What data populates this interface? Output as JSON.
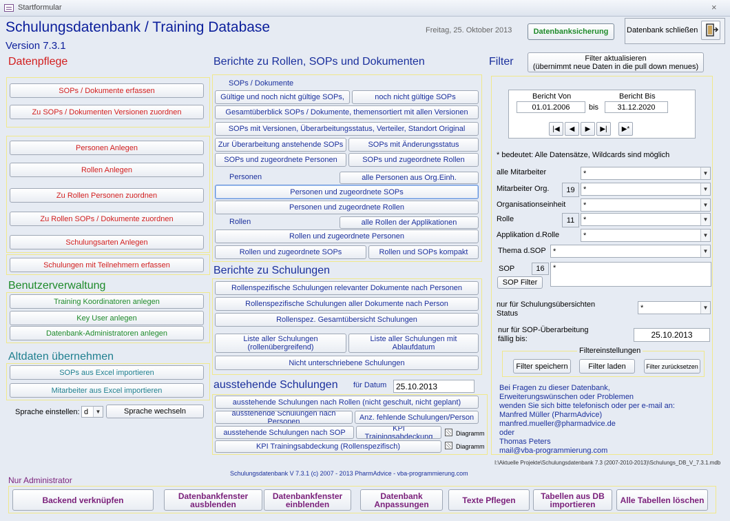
{
  "window": {
    "title": "Startformular",
    "close": "×"
  },
  "header": {
    "title": "Schulungsdatenbank / Training Database",
    "version": "Version 7.3.1",
    "date": "Freitag, 25. Oktober 2013",
    "backup_button": "Datenbanksicherung",
    "close_db_button": "Datenbank schließen"
  },
  "datenpflege": {
    "heading": "Datenpflege",
    "buttons": [
      "SOPs / Dokumente  erfassen",
      "Zu SOPs / Dokumenten Versionen zuordnen",
      "Personen Anlegen",
      "Rollen Anlegen",
      "Zu Rollen Personen zuordnen",
      "Zu Rollen SOPs  / Dokumente zuordnen",
      "Schulungsarten Anlegen",
      "Schulungen mit Teilnehmern erfassen"
    ]
  },
  "benutzer": {
    "heading": "Benutzerverwaltung",
    "buttons": [
      "Training Koordinatoren anlegen",
      "Key User anlegen",
      "Datenbank-Administratoren anlegen"
    ]
  },
  "altdaten": {
    "heading": "Altdaten übernehmen",
    "buttons": [
      "SOPs aus Excel importieren",
      "Mitarbeiter aus Excel importieren"
    ]
  },
  "sprache": {
    "label": "Sprache einstellen:",
    "value": "d",
    "button": "Sprache wechseln"
  },
  "berichte_rollen": {
    "heading": "Berichte zu Rollen, SOPs und Dokumenten",
    "sops_label": "SOPs / Dokumente",
    "personen_label": "Personen",
    "rollen_label": "Rollen",
    "b1": "Gültige und noch nicht gültige SOPs,",
    "b2": "noch nicht gültige SOPs",
    "b3": "Gesamtüberblick SOPs / Dokumente, themensortiert mit allen Versionen",
    "b4": "SOPs mit Versionen,  Überarbeitungsstatus, Verteiler, Standort Original",
    "b5": "Zur Überarbeitung anstehende SOPs",
    "b6": "SOPs mit Änderungsstatus",
    "b7": "SOPs und zugeordnete Personen",
    "b8": "SOPs und zugeordnete Rollen",
    "b9": "alle Personen aus Org.Einh.",
    "b10": "Personen und zugeordnete SOPs",
    "b11": "Personen und zugeordnete Rollen",
    "b12": "alle Rollen der Applikationen",
    "b13": "Rollen und zugeordnete Personen",
    "b14": "Rollen und zugeordnete SOPs",
    "b15": "Rollen und SOPs kompakt"
  },
  "berichte_schulungen": {
    "heading": "Berichte zu Schulungen",
    "b1": "Rollenspezifische Schulungen relevanter Dokumente nach Personen",
    "b2": "Rollenspezifische Schulungen aller Dokumente nach Person",
    "b3": "Rollenspez. Gesamtübersicht Schulungen",
    "b4a": "Liste aller Schulungen",
    "b4b": "(rollenübergreifend)",
    "b5a": "Liste aller Schulungen mit",
    "b5b": "Ablaufdatum",
    "b6": "Nicht unterschriebene Schulungen"
  },
  "ausstehend": {
    "heading": "ausstehende Schulungen",
    "date_label": "für Datum",
    "date_value": "25.10.2013",
    "b1": "ausstehende Schulungen nach Rollen (nicht geschult, nicht geplant)",
    "b2": "ausstehende Schulungen nach Personen",
    "b3": "Anz. fehlende Schulungen/Person",
    "b4": "ausstehende Schulungen nach SOP",
    "b5": "KPI Trainingsabdeckung",
    "b6": "KPI Trainingsabdeckung (Rollenspezifisch)",
    "chk_label": "Diagramm"
  },
  "filter": {
    "heading": "Filter",
    "update_button_1": "Filter aktualisieren",
    "update_button_2": "(übernimmt neue Daten in die pull down menues)",
    "von_label": "Bericht Von",
    "bis_label": "Bericht Bis",
    "von_value": "01.01.2006",
    "bis_sep": "bis",
    "bis_value": "31.12.2020",
    "wildcard_note": "* bedeutet: Alle Datensätze, Wildcards sind möglich",
    "mitarbeiter_label": "alle Mitarbeiter",
    "mitarbeiter_value": "*",
    "org_label": "Mitarbeiter Org.",
    "org_num": "19",
    "org_value": "*",
    "einheit_label": "Organisationseinheit",
    "einheit_value": "*",
    "rolle_label": "Rolle",
    "rolle_num": "11",
    "rolle_value": "*",
    "app_label": "Applikation d.Rolle",
    "app_value": "*",
    "thema_label": "Thema d.SOP",
    "thema_value": "*",
    "sop_label": "SOP",
    "sop_num": "16",
    "sop_value": "*",
    "sop_filter_button": "SOP Filter",
    "status_label_1": "nur für  Schulungsübersichten",
    "status_label_2": "Status",
    "status_value": "*",
    "faellig_label_1": "nur für  SOP-Überarbeitung",
    "faellig_label_2": "fällig bis:",
    "faellig_value": "25.10.2013",
    "settings_label": "Filtereinstellungen",
    "save_button": "Filter speichern",
    "load_button": "Filter laden",
    "reset_button": "Filter zurücksetzen"
  },
  "contact": {
    "lines": [
      "Bei Fragen zu dieser Datenbank,",
      "Erweiterungswünschen oder Problemen",
      "wenden Sie sich bitte telefonisch oder per e-mail an:",
      "Manfred Müller (PharmAdvice)",
      "manfred.mueller@pharmadvice.de",
      "oder",
      "Thomas Peters",
      "mail@vba-programmierung.com"
    ]
  },
  "path": "I:\\Aktuelle Projekte\\Schulungsdatenbank 7.3 (2007-2010-2013)\\Schulungs_DB_V_7.3.1.mdb",
  "footer": "Schulungsdatenbank V 7.3.1  (c) 2007 - 2013 PharmAdvice - vba-programmierung.com",
  "admin": {
    "heading": "Nur Administrator",
    "b1": "Backend verknüpfen",
    "b2a": "Datenbankfenster",
    "b2b": "ausblenden",
    "b3a": "Datenbankfenster",
    "b3b": "einblenden",
    "b4a": "Datenbank",
    "b4b": "Anpassungen",
    "b5": "Texte Pflegen",
    "b6a": "Tabellen aus DB",
    "b6b": "importieren",
    "b7": "Alle Tabellen löschen"
  },
  "colors": {
    "title_blue": "#0b1e9b",
    "red": "#d21d1d",
    "green": "#1e8a2a",
    "teal": "#1f7f8f",
    "purple": "#7a1f7a",
    "panel_border": "#f0e88a",
    "background": "#e6ebf3"
  }
}
